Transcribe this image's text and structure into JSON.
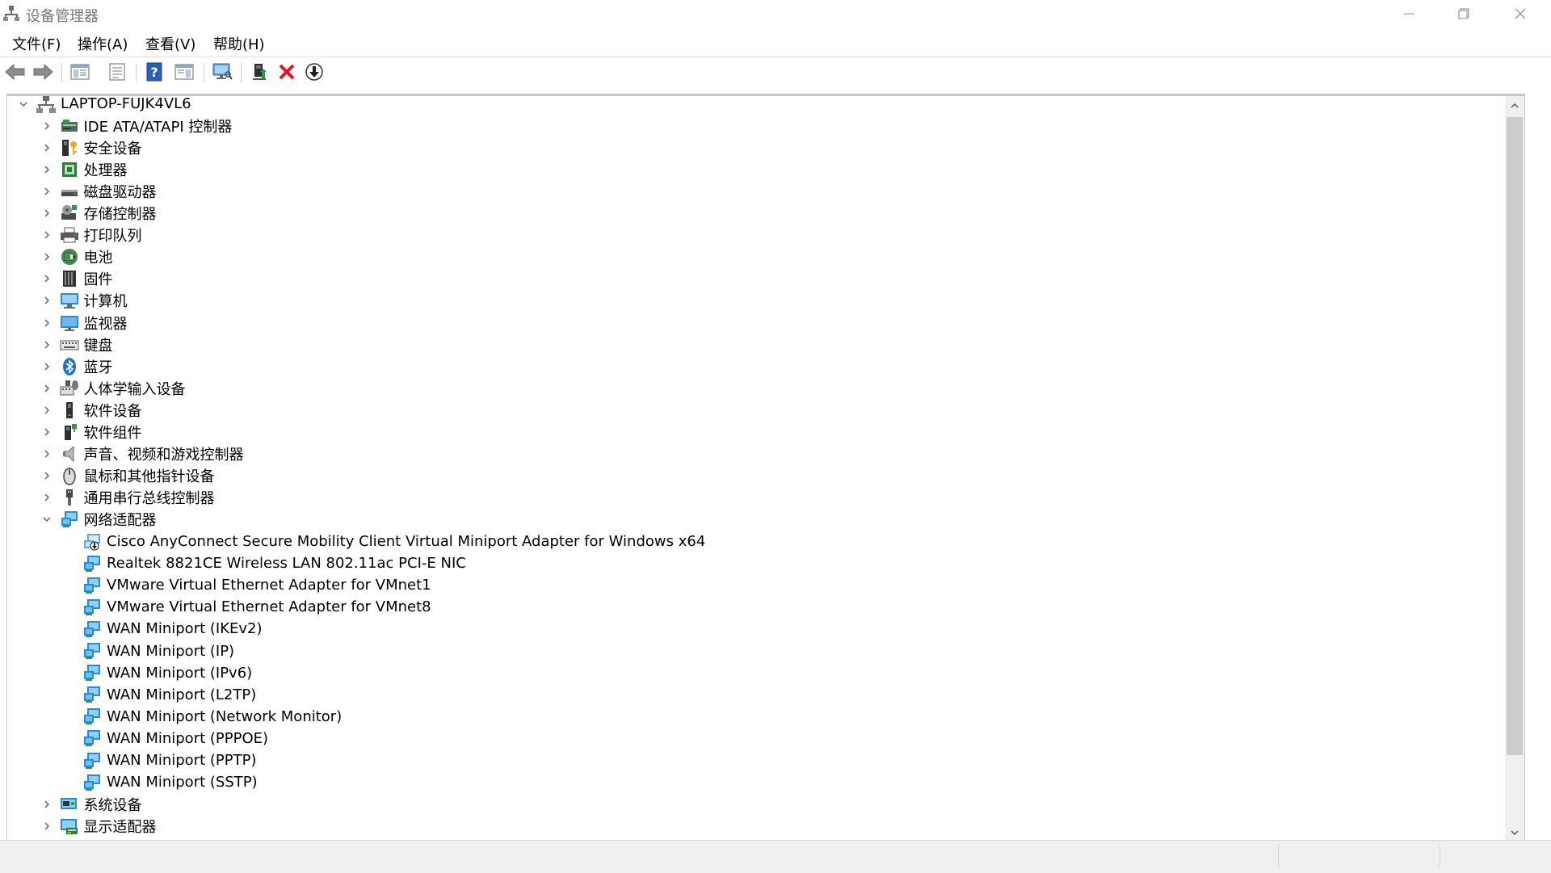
{
  "window": {
    "title": "设备管理器",
    "controls": [
      "minimize",
      "restore",
      "close"
    ]
  },
  "menu": [
    {
      "label": "文件(F)"
    },
    {
      "label": "操作(A)"
    },
    {
      "label": "查看(V)"
    },
    {
      "label": "帮助(H)"
    }
  ],
  "toolbar": {
    "buttons": [
      {
        "name": "back-button",
        "icon": "arrow-left-icon"
      },
      {
        "name": "forward-button",
        "icon": "arrow-right-icon"
      },
      {
        "name": "show-hide-console-tree-button",
        "icon": "console-tree-icon"
      },
      {
        "name": "properties-button",
        "icon": "properties-icon"
      },
      {
        "name": "help-button",
        "icon": "help-icon"
      },
      {
        "name": "show-action-pane-button",
        "icon": "action-pane-icon"
      },
      {
        "name": "scan-hardware-button",
        "icon": "monitor-scan-icon"
      },
      {
        "name": "update-driver-button",
        "icon": "update-driver-icon"
      },
      {
        "name": "uninstall-device-button",
        "icon": "red-x-icon"
      },
      {
        "name": "disable-device-button",
        "icon": "download-arrow-icon"
      }
    ]
  },
  "tree": {
    "root": {
      "label": "LAPTOP-FUJK4VL6",
      "expanded": true,
      "icon": "computer-network-icon"
    },
    "categories": [
      {
        "label": "IDE ATA/ATAPI 控制器",
        "icon": "ide-controller-icon",
        "expanded": false
      },
      {
        "label": "安全设备",
        "icon": "security-key-icon",
        "expanded": false
      },
      {
        "label": "处理器",
        "icon": "processor-icon",
        "expanded": false
      },
      {
        "label": "磁盘驱动器",
        "icon": "disk-drive-icon",
        "expanded": false
      },
      {
        "label": "存储控制器",
        "icon": "storage-controller-icon",
        "expanded": false
      },
      {
        "label": "打印队列",
        "icon": "printer-icon",
        "expanded": false
      },
      {
        "label": "电池",
        "icon": "battery-icon",
        "expanded": false
      },
      {
        "label": "固件",
        "icon": "firmware-icon",
        "expanded": false
      },
      {
        "label": "计算机",
        "icon": "computer-icon",
        "expanded": false
      },
      {
        "label": "监视器",
        "icon": "monitor-icon",
        "expanded": false
      },
      {
        "label": "键盘",
        "icon": "keyboard-icon",
        "expanded": false
      },
      {
        "label": "蓝牙",
        "icon": "bluetooth-icon",
        "expanded": false
      },
      {
        "label": "人体学输入设备",
        "icon": "hid-icon",
        "expanded": false
      },
      {
        "label": "软件设备",
        "icon": "software-device-icon",
        "expanded": false
      },
      {
        "label": "软件组件",
        "icon": "software-component-icon",
        "expanded": false
      },
      {
        "label": "声音、视频和游戏控制器",
        "icon": "speaker-icon",
        "expanded": false
      },
      {
        "label": "鼠标和其他指针设备",
        "icon": "mouse-icon",
        "expanded": false
      },
      {
        "label": "通用串行总线控制器",
        "icon": "usb-icon",
        "expanded": false
      },
      {
        "label": "网络适配器",
        "icon": "network-adapter-icon",
        "expanded": true,
        "children": [
          {
            "label": "Cisco AnyConnect Secure Mobility Client Virtual Miniport Adapter for Windows x64",
            "icon": "network-adapter-disabled-icon"
          },
          {
            "label": "Realtek 8821CE Wireless LAN 802.11ac PCI-E NIC",
            "icon": "network-adapter-icon"
          },
          {
            "label": "VMware Virtual Ethernet Adapter for VMnet1",
            "icon": "network-adapter-icon"
          },
          {
            "label": "VMware Virtual Ethernet Adapter for VMnet8",
            "icon": "network-adapter-icon"
          },
          {
            "label": "WAN Miniport (IKEv2)",
            "icon": "network-adapter-icon"
          },
          {
            "label": "WAN Miniport (IP)",
            "icon": "network-adapter-icon"
          },
          {
            "label": "WAN Miniport (IPv6)",
            "icon": "network-adapter-icon"
          },
          {
            "label": "WAN Miniport (L2TP)",
            "icon": "network-adapter-icon"
          },
          {
            "label": "WAN Miniport (Network Monitor)",
            "icon": "network-adapter-icon"
          },
          {
            "label": "WAN Miniport (PPPOE)",
            "icon": "network-adapter-icon"
          },
          {
            "label": "WAN Miniport (PPTP)",
            "icon": "network-adapter-icon"
          },
          {
            "label": "WAN Miniport (SSTP)",
            "icon": "network-adapter-icon"
          }
        ]
      },
      {
        "label": "系统设备",
        "icon": "system-device-icon",
        "expanded": false
      },
      {
        "label": "显示适配器",
        "icon": "display-adapter-icon",
        "expanded": false
      }
    ]
  },
  "colors": {
    "accent_blue": "#1e73c8",
    "red_x": "#e81123",
    "green": "#2d9a3b",
    "gray_text": "#777777"
  }
}
